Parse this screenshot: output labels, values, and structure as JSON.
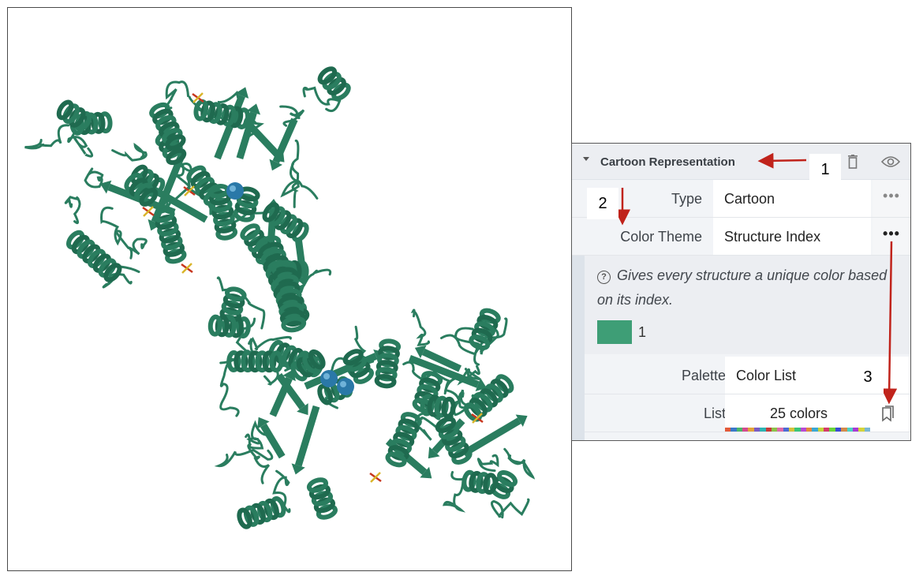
{
  "panel": {
    "title": "Cartoon Representation",
    "rows": {
      "type": {
        "label": "Type",
        "value": "Cartoon",
        "more": "•••"
      },
      "color_theme": {
        "label": "Color Theme",
        "value": "Structure Index",
        "more": "•••"
      }
    },
    "theme": {
      "help_icon": "?",
      "description": "Gives every structure a unique color based on its index.",
      "swatch_color": "#3e9e76",
      "swatch_label": "1"
    },
    "palette": {
      "label": "Palette",
      "value": "Color List"
    },
    "list": {
      "label": "List",
      "value": "25 colors"
    },
    "icons": [
      "trash-icon",
      "eye-icon",
      "bookmark-icon",
      "help-icon"
    ]
  },
  "annotations": {
    "marker_1": "1",
    "marker_2": "2",
    "marker_3": "3",
    "arrow_color": "#c0231b"
  },
  "colors": {
    "protein": "#2a7d5f",
    "protein_dark": "#1f6a4f",
    "ion": "#2a78a8",
    "ligand_red": "#c7361e",
    "ligand_yellow": "#d9b52a"
  },
  "colorbar": [
    "#e25a3a",
    "#3a78c9",
    "#49b86a",
    "#d44a8f",
    "#e3a33a",
    "#7a5bc4",
    "#2eb3b3",
    "#c93a3a",
    "#8cc24a",
    "#e06aa8",
    "#4a6cd4",
    "#d4c23a",
    "#3ac47a",
    "#b84ad4",
    "#e38a3a",
    "#3aa8d4",
    "#c4d43a",
    "#d43a6a",
    "#6ad43a",
    "#3a4ad4",
    "#d48a4a",
    "#4ad4c4",
    "#a83ad4",
    "#d4d43a",
    "#7ab8d4"
  ]
}
